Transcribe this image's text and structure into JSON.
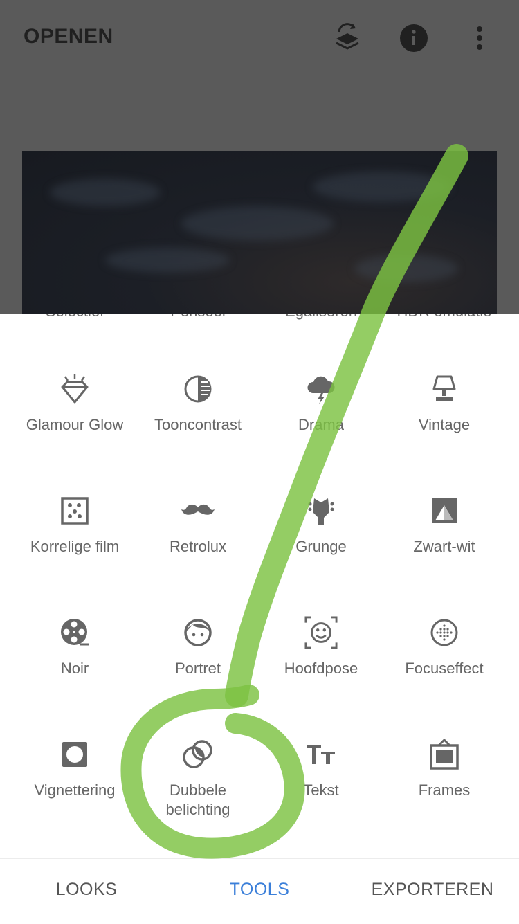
{
  "topbar": {
    "open_label": "OPENEN",
    "icons": [
      "layers-history-icon",
      "info-icon",
      "more-vert-icon"
    ]
  },
  "cut_row": [
    "Selectief",
    "Penseel",
    "Egaliseren",
    "HDR emulatie"
  ],
  "tools": [
    {
      "label": "Glamour Glow",
      "icon": "diamond-glow-icon"
    },
    {
      "label": "Tooncontrast",
      "icon": "tonal-contrast-icon"
    },
    {
      "label": "Drama",
      "icon": "storm-cloud-icon"
    },
    {
      "label": "Vintage",
      "icon": "lamp-icon"
    },
    {
      "label": "Korrelige film",
      "icon": "grain-film-icon"
    },
    {
      "label": "Retrolux",
      "icon": "mustache-icon"
    },
    {
      "label": "Grunge",
      "icon": "guitar-head-icon"
    },
    {
      "label": "Zwart-wit",
      "icon": "black-white-icon"
    },
    {
      "label": "Noir",
      "icon": "film-reel-icon"
    },
    {
      "label": "Portret",
      "icon": "face-icon"
    },
    {
      "label": "Hoofdpose",
      "icon": "head-pose-icon"
    },
    {
      "label": "Focuseffect",
      "icon": "lens-blur-icon"
    },
    {
      "label": "Vignettering",
      "icon": "vignette-icon"
    },
    {
      "label": "Dubbele belichting",
      "icon": "double-exposure-icon"
    },
    {
      "label": "Tekst",
      "icon": "text-icon"
    },
    {
      "label": "Frames",
      "icon": "frame-icon"
    }
  ],
  "bottom_tabs": [
    {
      "label": "LOOKS",
      "active": false
    },
    {
      "label": "TOOLS",
      "active": true
    },
    {
      "label": "EXPORTEREN",
      "active": false
    }
  ],
  "colors": {
    "icon": "#666666",
    "accent": "#3b7fd9",
    "annotation": "#7cc242",
    "overlay": "#5a5a5a"
  }
}
